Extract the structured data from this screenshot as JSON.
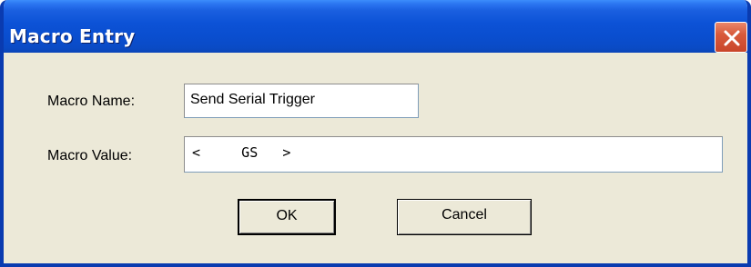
{
  "window": {
    "title": "Macro Entry"
  },
  "form": {
    "name_label": "Macro Name:",
    "name_value": "Send Serial Trigger",
    "value_label": "Macro Value:",
    "value_value": "<     GS   >"
  },
  "buttons": {
    "ok_label": "OK",
    "cancel_label": "Cancel"
  },
  "icons": {
    "close": "close-icon"
  },
  "colors": {
    "titlebar": "#0a4ecf",
    "dialog_background": "#ece9d8",
    "close_button": "#d85a3b"
  }
}
